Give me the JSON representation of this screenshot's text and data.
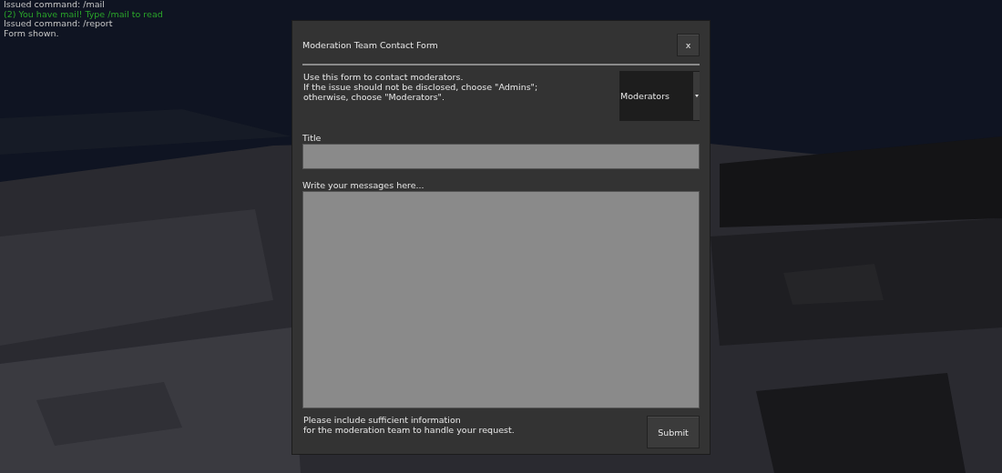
{
  "chat": [
    {
      "kind": "system",
      "text": "Issued command: /mail"
    },
    {
      "kind": "mail",
      "text": "(2) You have mail! Type /mail to read"
    },
    {
      "kind": "system",
      "text": "Issued command: /report"
    },
    {
      "kind": "system",
      "text": "Form shown."
    }
  ],
  "dialog": {
    "title": "Moderation Team Contact Form",
    "close": "x",
    "intro": "Use this form to contact moderators.\nIf the issue should not be disclosed, choose \"Admins\";\notherwise, choose \"Moderators\".",
    "recipient": {
      "value": "Moderators"
    },
    "title_label": "Title",
    "message_label": "Write your messages here...",
    "footer_note": "Please include sufficient information\nfor the moderation team to handle your request.",
    "submit": "Submit"
  }
}
